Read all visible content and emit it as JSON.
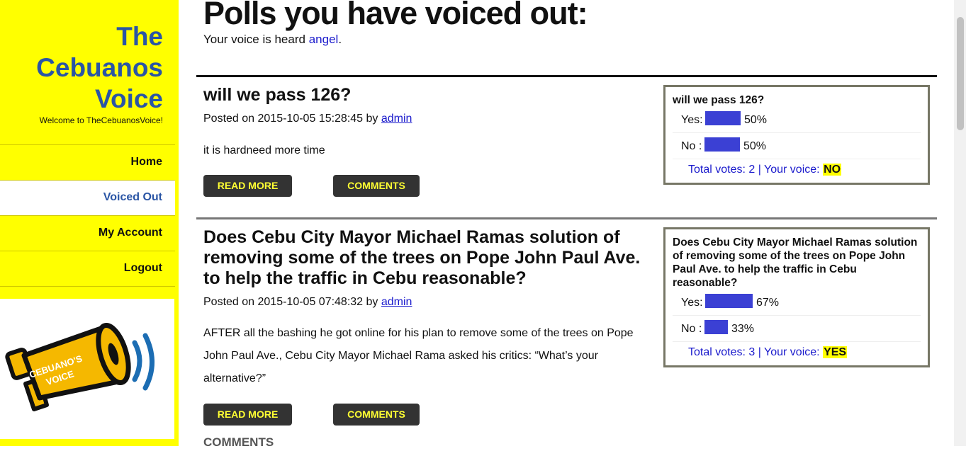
{
  "brand": {
    "title_lines": [
      "The",
      "Cebuanos",
      "Voice"
    ],
    "subtitle": "Welcome to TheCebuanosVoice!",
    "logo_text": [
      "CEBUANO'S",
      "VOICE"
    ]
  },
  "nav": [
    {
      "label": "Home",
      "active": false
    },
    {
      "label": "Voiced Out",
      "active": true
    },
    {
      "label": "My Account",
      "active": false
    },
    {
      "label": "Logout",
      "active": false
    }
  ],
  "page": {
    "title": "Polls you have voiced out:",
    "welcome_prefix": "Your voice is heard",
    "username": "angel",
    "welcome_suffix": "."
  },
  "posts": [
    {
      "title": "will we pass 126?",
      "posted_prefix": "Posted on 2015-10-05 15:28:45 by",
      "author": "admin",
      "body": "it is hardneed more time",
      "read_more": "READ MORE",
      "comments": "COMMENTS",
      "poll": {
        "question": "will we pass 126?",
        "options": [
          {
            "label": "Yes:",
            "percent": 50,
            "percent_text": "50%"
          },
          {
            "label": "No :",
            "percent": 50,
            "percent_text": "50%"
          }
        ],
        "total_text": "Total votes: 2 | Your voice:",
        "your_voice": "NO"
      }
    },
    {
      "title": "Does Cebu City Mayor Michael Ramas solution of removing some of the trees on Pope John Paul Ave. to help the traffic in Cebu reasonable?",
      "posted_prefix": "Posted on 2015-10-05 07:48:32 by",
      "author": "admin",
      "body": "AFTER all the bashing he got online for his plan to remove some of the trees on Pope John Paul Ave., Cebu City Mayor Michael Rama asked his critics: “What’s your alternative?”",
      "read_more": "READ MORE",
      "comments": "COMMENTS",
      "comments_heading": "COMMENTS",
      "poll": {
        "question": "Does Cebu City Mayor Michael Ramas solution of removing some of the trees on Pope John Paul Ave. to help the traffic in Cebu reasonable?",
        "options": [
          {
            "label": "Yes:",
            "percent": 67,
            "percent_text": "67%"
          },
          {
            "label": "No :",
            "percent": 33,
            "percent_text": "33%"
          }
        ],
        "total_text": "Total votes: 3 | Your voice:",
        "your_voice": "YES"
      }
    }
  ],
  "colors": {
    "sidebar": "#ffff00",
    "brand": "#2a55a5",
    "bar": "#3b40d4",
    "link": "#1a1acc",
    "button_bg": "#333333",
    "button_text": "#ffff33"
  }
}
